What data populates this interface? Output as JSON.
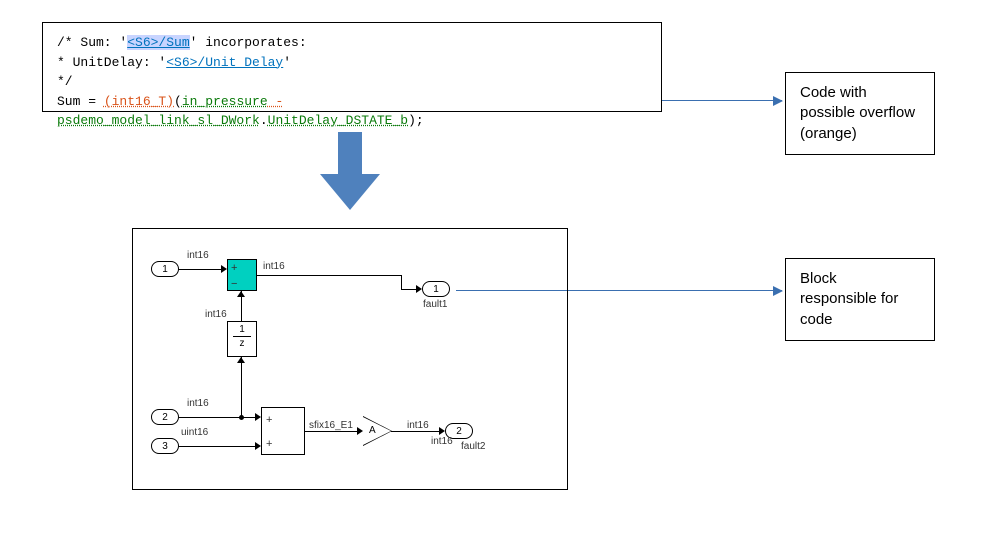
{
  "code": {
    "comment1_a": "/* Sum: '",
    "comment1_link": "<S6>/Sum",
    "comment1_b": "' incorporates:",
    "comment2_a": " *  UnitDelay: '",
    "comment2_link": "<S6>/Unit Delay",
    "comment2_b": "'",
    "comment3": " */",
    "line_a": "Sum = ",
    "cast": "(int16_T)",
    "paren_open": "(",
    "var1": "in_pressure",
    "minus": " - ",
    "var2": "psdemo_model_link_sl_DWork",
    "dot": ".",
    "var3": "UnitDelay_DSTATE_b",
    "tail": ");"
  },
  "labels": {
    "box1_l1": "Code with",
    "box1_l2": "possible overflow",
    "box1_l3": "(orange)",
    "box2_l1": "Block",
    "box2_l2": "responsible for",
    "box2_l3": "code"
  },
  "diagram": {
    "port1": "1",
    "port2": "2",
    "port3": "3",
    "outport1": "1",
    "outport2": "2",
    "dt_int16": "int16",
    "dt_uint16": "uint16",
    "dt_sfix": "sfix16_E1",
    "fault1": "fault1",
    "fault2": "fault2",
    "delay_top": "1",
    "delay_bot": "z",
    "gain": "A"
  }
}
